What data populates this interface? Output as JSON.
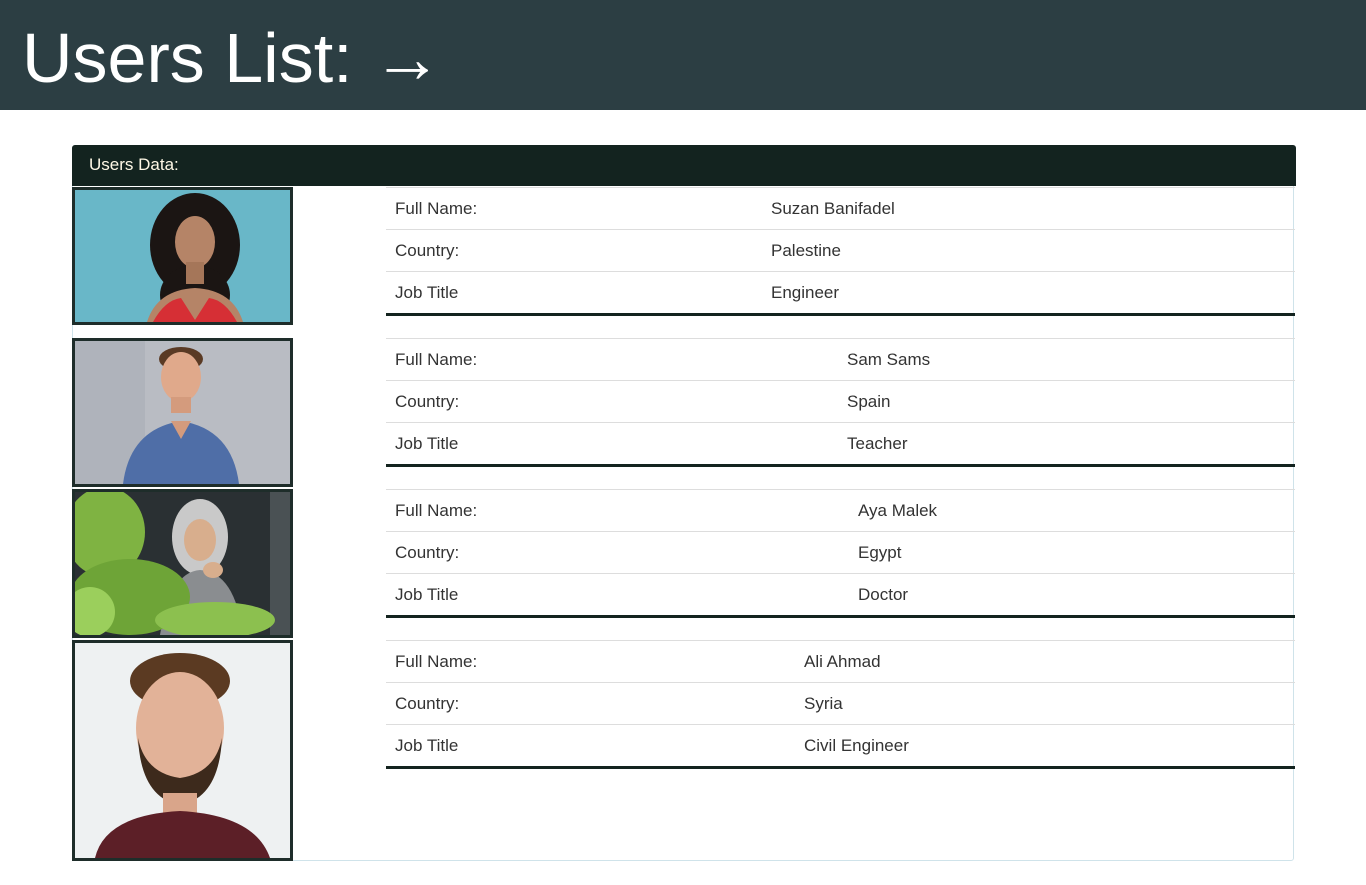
{
  "header": {
    "title": "Users List: →"
  },
  "panel": {
    "heading": "Users Data:"
  },
  "labels": {
    "full_name": "Full Name:",
    "country": "Country:",
    "job_title": "Job Title"
  },
  "users": [
    {
      "full_name": "Suzan Banifadel",
      "country": "Palestine",
      "job_title": "Engineer",
      "photo_icon": "woman-curly-hair-portrait"
    },
    {
      "full_name": "Sam Sams",
      "country": "Spain",
      "job_title": "Teacher",
      "photo_icon": "man-blue-shirt-portrait"
    },
    {
      "full_name": "Aya Malek",
      "country": "Egypt",
      "job_title": "Doctor",
      "photo_icon": "woman-hijab-portrait"
    },
    {
      "full_name": "Ali Ahmad",
      "country": "Syria",
      "job_title": "Civil Engineer",
      "photo_icon": "man-beard-portrait"
    }
  ],
  "colors": {
    "header_bg": "#2c3e43",
    "panel_heading_bg": "#13231f",
    "panel_border": "#cfe3ea"
  }
}
